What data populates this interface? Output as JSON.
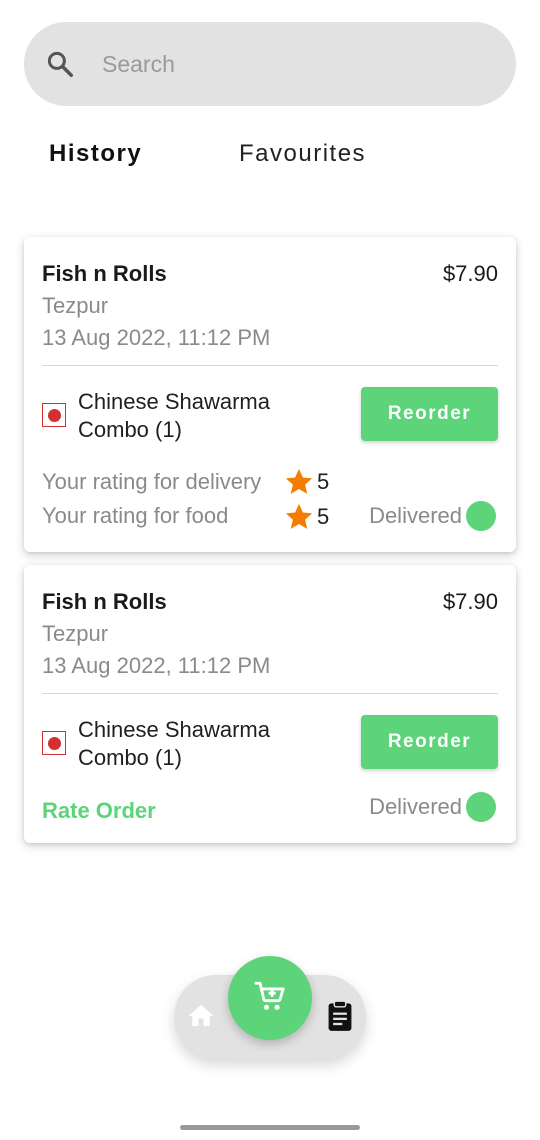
{
  "search": {
    "placeholder": "Search",
    "value": ""
  },
  "tabs": [
    {
      "label": "History",
      "active": true
    },
    {
      "label": "Favourites",
      "active": false
    }
  ],
  "orders": [
    {
      "restaurant": "Fish n Rolls",
      "price": "$7.90",
      "city": "Tezpur",
      "date": "13 Aug 2022, 11:12 PM",
      "item": "Chinese Shawarma Combo (1)",
      "reorder_label": "Reorder",
      "delivery_rating_label": "Your rating for delivery",
      "delivery_rating": "5",
      "food_rating_label": "Your rating for food",
      "food_rating": "5",
      "status": "Delivered"
    },
    {
      "restaurant": "Fish n Rolls",
      "price": "$7.90",
      "city": "Tezpur",
      "date": "13 Aug 2022, 11:12 PM",
      "item": "Chinese Shawarma Combo (1)",
      "reorder_label": "Reorder",
      "rate_label": "Rate Order",
      "status": "Delivered"
    }
  ],
  "nav": {
    "home_icon": "home-icon",
    "cart_icon": "cart-icon",
    "orders_icon": "clipboard-icon"
  },
  "colors": {
    "accent": "#5dd479",
    "star": "#f57c00",
    "veg_mark": "#d32f2f"
  }
}
